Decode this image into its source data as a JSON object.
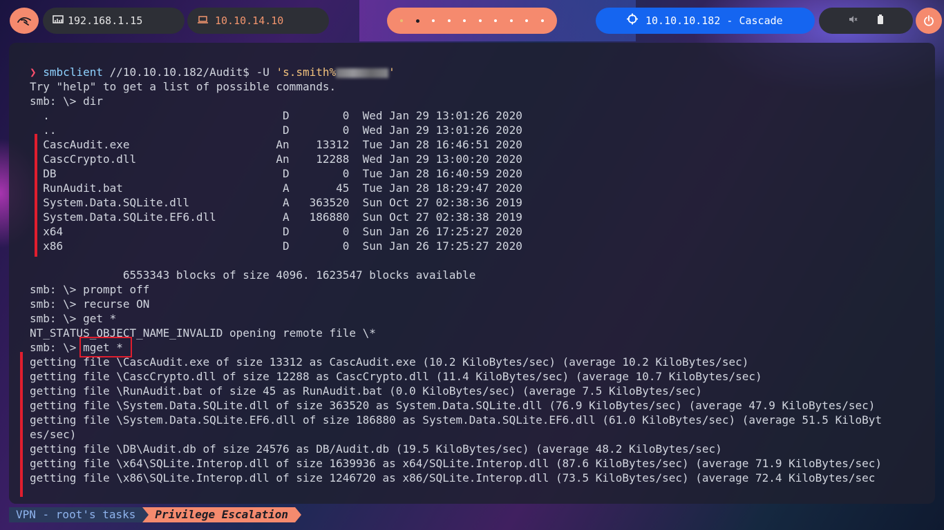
{
  "topbar": {
    "logo_icon": "kali-dragon-icon",
    "local_ip": "192.168.1.15",
    "vpn_ip": "10.10.14.10",
    "target": "10.10.10.182 - Cascade",
    "accent_color": "#f58a6e",
    "target_color": "#1565f0"
  },
  "terminal": {
    "command": {
      "prompt": "❯",
      "program": "smbclient",
      "share": "//10.10.10.182/Audit$",
      "option": "-U",
      "user_prefix": "'s.smith%",
      "user_suffix": "'"
    },
    "lines": [
      "Try \"help\" to get a list of possible commands.",
      "smb: \\> dir",
      "  .                                   D        0  Wed Jan 29 13:01:26 2020",
      "  ..                                  D        0  Wed Jan 29 13:01:26 2020",
      "  CascAudit.exe                      An    13312  Tue Jan 28 16:46:51 2020",
      "  CascCrypto.dll                     An    12288  Wed Jan 29 13:00:20 2020",
      "  DB                                  D        0  Tue Jan 28 16:40:59 2020",
      "  RunAudit.bat                        A       45  Tue Jan 28 18:29:47 2020",
      "  System.Data.SQLite.dll              A   363520  Sun Oct 27 02:38:36 2019",
      "  System.Data.SQLite.EF6.dll          A   186880  Sun Oct 27 02:38:38 2019",
      "  x64                                 D        0  Sun Jan 26 17:25:27 2020",
      "  x86                                 D        0  Sun Jan 26 17:25:27 2020",
      "",
      "              6553343 blocks of size 4096. 1623547 blocks available",
      "smb: \\> prompt off",
      "smb: \\> recurse ON",
      "smb: \\> get *",
      "NT_STATUS_OBJECT_NAME_INVALID opening remote file \\*",
      "smb: \\> mget *",
      "getting file \\CascAudit.exe of size 13312 as CascAudit.exe (10.2 KiloBytes/sec) (average 10.2 KiloBytes/sec)",
      "getting file \\CascCrypto.dll of size 12288 as CascCrypto.dll (11.4 KiloBytes/sec) (average 10.7 KiloBytes/sec)",
      "getting file \\RunAudit.bat of size 45 as RunAudit.bat (0.0 KiloBytes/sec) (average 7.5 KiloBytes/sec)",
      "getting file \\System.Data.SQLite.dll of size 363520 as System.Data.SQLite.dll (76.9 KiloBytes/sec) (average 47.9 KiloBytes/sec)",
      "getting file \\System.Data.SQLite.EF6.dll of size 186880 as System.Data.SQLite.EF6.dll (61.0 KiloBytes/sec) (average 51.5 KiloByt",
      "es/sec)",
      "getting file \\DB\\Audit.db of size 24576 as DB/Audit.db (19.5 KiloBytes/sec) (average 48.2 KiloBytes/sec)",
      "getting file \\x64\\SQLite.Interop.dll of size 1639936 as x64/SQLite.Interop.dll (87.6 KiloBytes/sec) (average 71.9 KiloBytes/sec)",
      "getting file \\x86\\SQLite.Interop.dll of size 1246720 as x86/SQLite.Interop.dll (73.5 KiloBytes/sec) (average 72.4 KiloBytes/sec"
    ]
  },
  "bottombar": {
    "session": "VPN - root's tasks",
    "window": "Privilege Escalation"
  }
}
